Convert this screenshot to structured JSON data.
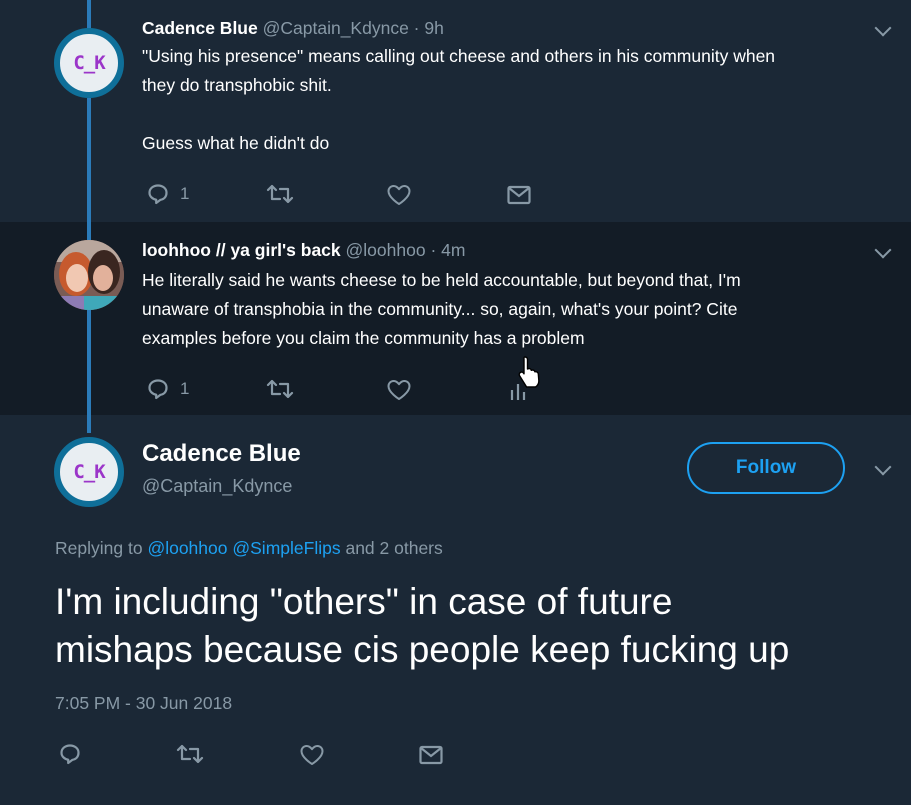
{
  "reply1": {
    "name": "Cadence Blue",
    "handle": "@Captain_Kdynce",
    "time": "· 9h",
    "avatar_text": "C_K",
    "text_line1": "\"Using his presence\" means calling out cheese and others in his community when",
    "text_line2": "they do transphobic shit.",
    "text_line3": "Guess what he didn't do",
    "reply_count": "1"
  },
  "reply2": {
    "name": "loohhoo // ya girl's back",
    "handle": "@loohhoo",
    "time": "· 4m",
    "text_line1": "He literally said he wants cheese to be held accountable, but beyond that, I'm",
    "text_line2": "unaware of transphobia in the community... so, again, what's your point? Cite",
    "text_line3": "examples before you claim the community has a problem",
    "reply_count": "1"
  },
  "main_tweet": {
    "name": "Cadence Blue",
    "handle": "@Captain_Kdynce",
    "avatar_text": "C_K",
    "follow_label": "Follow",
    "replying_prefix": "Replying to",
    "replying_user1": "@loohhoo",
    "replying_user2": "@SimpleFlips",
    "replying_suffix": "and 2 others",
    "text_line1": "I'm including \"others\" in case of future",
    "text_line2": "mishaps because cis people keep fucking up",
    "timestamp": "7:05 PM - 30 Jun 2018"
  },
  "colors": {
    "background": "#1b2836",
    "highlight_bg": "#131c26",
    "accent": "#1da1f2",
    "muted": "#8899a6",
    "thread_line": "#2b7bb9"
  },
  "icons": [
    "reply-icon",
    "retweet-icon",
    "like-icon",
    "message-icon",
    "chevron-down-icon",
    "cursor-icon"
  ]
}
